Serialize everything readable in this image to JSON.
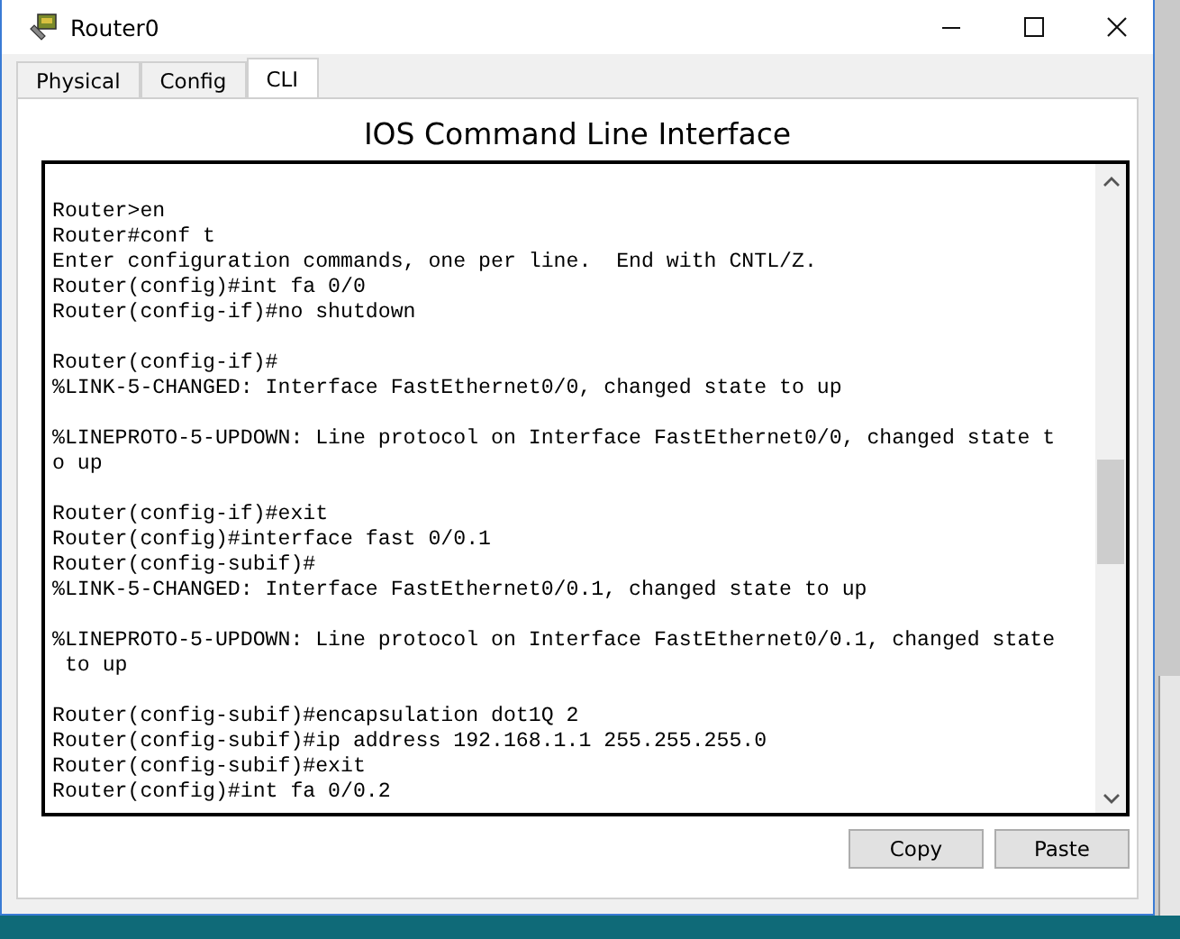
{
  "window": {
    "title": "Router0"
  },
  "tabs": [
    {
      "label": "Physical",
      "selected": false
    },
    {
      "label": "Config",
      "selected": false
    },
    {
      "label": "CLI",
      "selected": true
    }
  ],
  "heading": "IOS Command Line Interface",
  "terminal": {
    "blocks": [
      [
        "Router>en",
        "Router#conf t",
        "Enter configuration commands, one per line.  End with CNTL/Z.",
        "Router(config)#int fa 0/0",
        "Router(config-if)#no shutdown"
      ],
      [
        "Router(config-if)#",
        "%LINK-5-CHANGED: Interface FastEthernet0/0, changed state to up"
      ],
      [
        "%LINEPROTO-5-UPDOWN: Line protocol on Interface FastEthernet0/0, changed state t",
        "o up"
      ],
      [
        "Router(config-if)#exit",
        "Router(config)#interface fast 0/0.1",
        "Router(config-subif)#",
        "%LINK-5-CHANGED: Interface FastEthernet0/0.1, changed state to up"
      ],
      [
        "%LINEPROTO-5-UPDOWN: Line protocol on Interface FastEthernet0/0.1, changed state",
        " to up"
      ],
      [
        "Router(config-subif)#encapsulation dot1Q 2",
        "Router(config-subif)#ip address 192.168.1.1 255.255.255.0",
        "Router(config-subif)#exit",
        "Router(config)#int fa 0/0.2"
      ]
    ]
  },
  "buttons": [
    "Copy",
    "Paste"
  ]
}
